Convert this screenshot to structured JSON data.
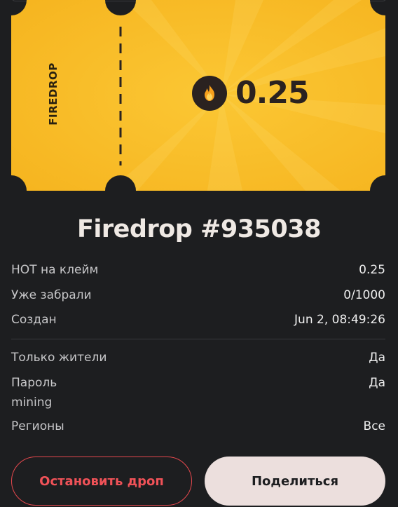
{
  "ticket": {
    "stub_label": "FIREDROP",
    "amount": "0.25",
    "coin_icon": "flame-icon",
    "colors": {
      "ticket": "#f9bd2a",
      "coin_bg": "#2a2220",
      "flame": "#f7a01c"
    }
  },
  "title": "Firedrop #935038",
  "details": [
    {
      "label": "HOT на клейм",
      "value": "0.25"
    },
    {
      "label": "Уже забрали",
      "value": "0/1000"
    },
    {
      "label": "Создан",
      "value": "Jun 2, 08:49:26"
    }
  ],
  "settings": [
    {
      "label": "Только жители",
      "value": "Да"
    },
    {
      "label": "Пароль",
      "sublabel": "mining",
      "value": "Да"
    },
    {
      "label": "Регионы",
      "value": "Все"
    }
  ],
  "buttons": {
    "stop": "Остановить дроп",
    "share": "Поделиться"
  },
  "colors": {
    "background": "#1d1e20",
    "danger": "#e5484d",
    "share_bg": "#ecdfdd"
  }
}
